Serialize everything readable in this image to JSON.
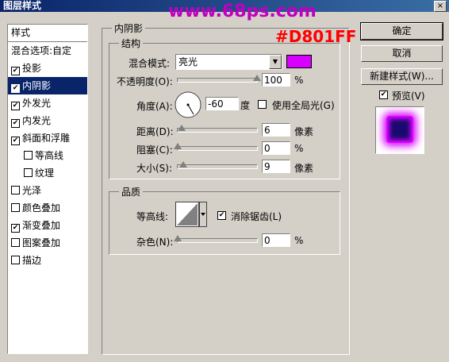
{
  "window": {
    "title": "图层样式",
    "close_label": "×"
  },
  "watermark": "www.68ps.com",
  "note_color_text": "#D801FF",
  "left_panel": {
    "header": "样式",
    "blend_options": "混合选项:自定",
    "items": [
      {
        "label": "投影",
        "checked": true,
        "sub": false,
        "selected": false
      },
      {
        "label": "内阴影",
        "checked": true,
        "sub": false,
        "selected": true
      },
      {
        "label": "外发光",
        "checked": true,
        "sub": false,
        "selected": false
      },
      {
        "label": "内发光",
        "checked": true,
        "sub": false,
        "selected": false
      },
      {
        "label": "斜面和浮雕",
        "checked": true,
        "sub": false,
        "selected": false
      },
      {
        "label": "等高线",
        "checked": false,
        "sub": true,
        "selected": false
      },
      {
        "label": "纹理",
        "checked": false,
        "sub": true,
        "selected": false
      },
      {
        "label": "光泽",
        "checked": false,
        "sub": false,
        "selected": false
      },
      {
        "label": "颜色叠加",
        "checked": false,
        "sub": false,
        "selected": false
      },
      {
        "label": "渐变叠加",
        "checked": true,
        "sub": false,
        "selected": false
      },
      {
        "label": "图案叠加",
        "checked": false,
        "sub": false,
        "selected": false
      },
      {
        "label": "描边",
        "checked": false,
        "sub": false,
        "selected": false
      }
    ]
  },
  "main": {
    "section_title": "内阴影",
    "structure": {
      "title": "结构",
      "blend_mode_label": "混合模式:",
      "blend_mode_value": "亮光",
      "color_swatch": "#d801ff",
      "opacity_label": "不透明度(O):",
      "opacity_value": "100",
      "opacity_fraction": 1.0,
      "percent": "%",
      "angle_label": "角度(A):",
      "angle_value": "-60",
      "degree": "度",
      "global_light_label": "使用全局光(G)",
      "global_light_checked": false,
      "distance_label": "距离(D):",
      "distance_value": "6",
      "pixels": "像素",
      "choke_label": "阻塞(C):",
      "choke_value": "0",
      "size_label": "大小(S):",
      "size_value": "9"
    },
    "quality": {
      "title": "品质",
      "contour_label": "等高线:",
      "antialias_label": "消除锯齿(L)",
      "antialias_checked": true,
      "noise_label": "杂色(N):",
      "noise_value": "0",
      "percent": "%"
    }
  },
  "buttons": {
    "ok": "确定",
    "cancel": "取消",
    "new_style": "新建样式(W)...",
    "preview_label": "预览(V)",
    "preview_checked": true
  },
  "preview_colors": {
    "glow": "#d801ff",
    "inner": "#1a0a6e"
  }
}
